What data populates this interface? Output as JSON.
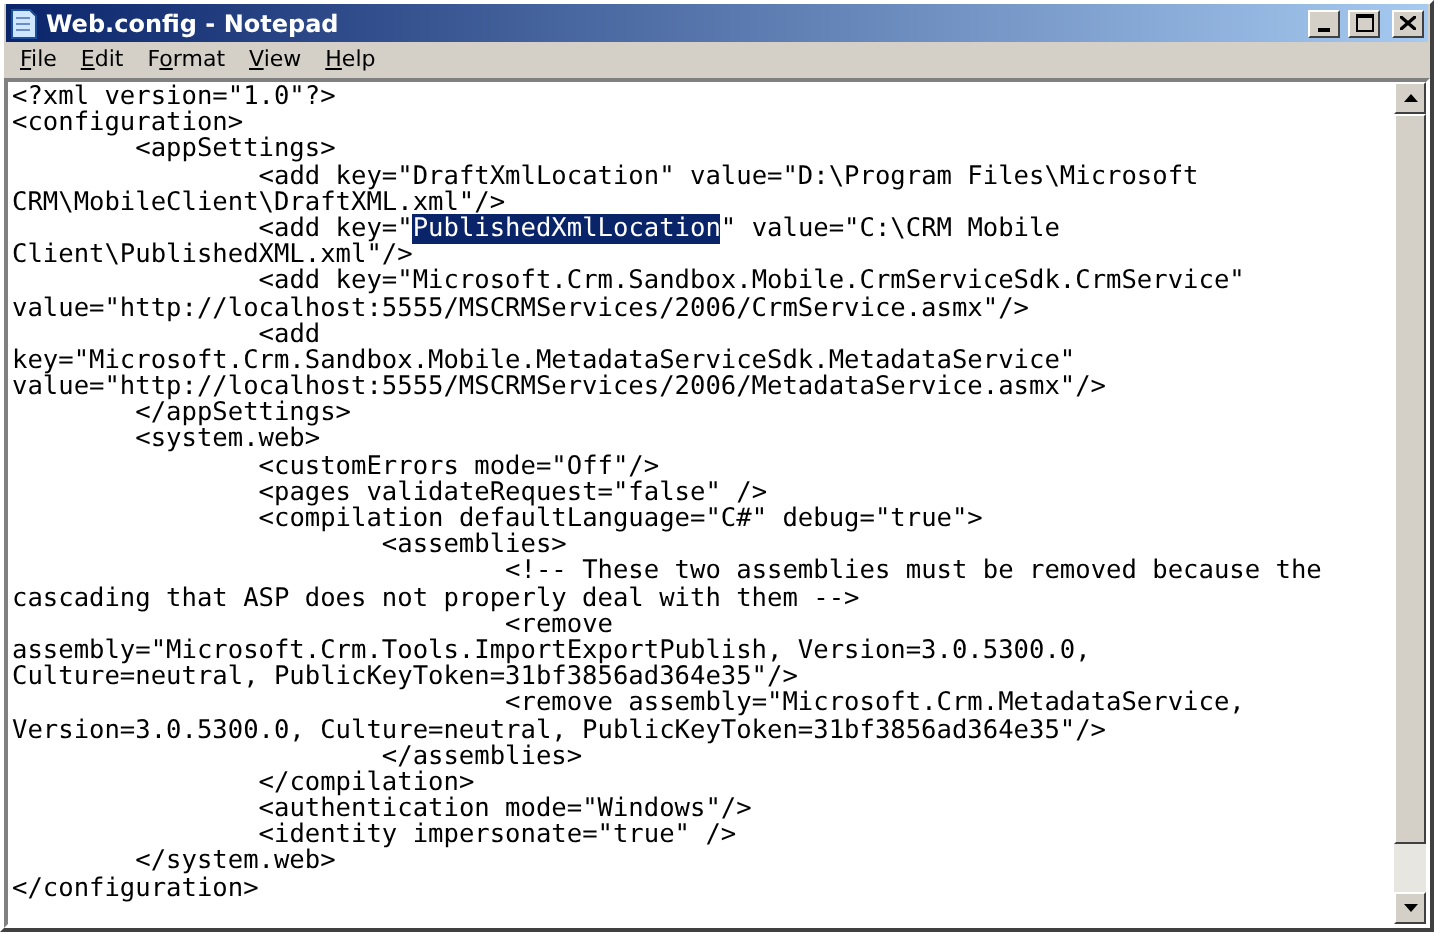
{
  "window": {
    "title": "Web.config - Notepad"
  },
  "menu": [
    {
      "accel": "F",
      "rest": "ile"
    },
    {
      "accel": "E",
      "rest": "dit"
    },
    {
      "pre": "F",
      "accel": "o",
      "rest": "rmat"
    },
    {
      "accel": "V",
      "rest": "iew"
    },
    {
      "accel": "H",
      "rest": "elp"
    }
  ],
  "editor": {
    "lines": [
      [
        {
          "text": "<?xml version=\"1.0\"?>",
          "selected": false
        }
      ],
      [
        {
          "text": "<configuration>",
          "selected": false
        }
      ],
      [
        {
          "text": "\t<appSettings>",
          "selected": false
        }
      ],
      [
        {
          "text": "\t\t<add key=\"DraftXmlLocation\" value=\"D:\\Program Files\\Microsoft",
          "selected": false
        }
      ],
      [
        {
          "text": "CRM\\MobileClient\\DraftXML.xml\"/>",
          "selected": false
        }
      ],
      [
        {
          "text": "\t\t<add key=\"",
          "selected": false
        },
        {
          "text": "PublishedXmlLocation",
          "selected": true
        },
        {
          "text": "\" value=\"C:\\CRM Mobile",
          "selected": false
        }
      ],
      [
        {
          "text": "Client\\PublishedXML.xml\"/>",
          "selected": false
        }
      ],
      [
        {
          "text": "\t\t<add key=\"Microsoft.Crm.Sandbox.Mobile.CrmServiceSdk.CrmService\"",
          "selected": false
        }
      ],
      [
        {
          "text": "value=\"http://localhost:5555/MSCRMServices/2006/CrmService.asmx\"/>",
          "selected": false
        }
      ],
      [
        {
          "text": "\t\t<add",
          "selected": false
        }
      ],
      [
        {
          "text": "key=\"Microsoft.Crm.Sandbox.Mobile.MetadataServiceSdk.MetadataService\"",
          "selected": false
        }
      ],
      [
        {
          "text": "value=\"http://localhost:5555/MSCRMServices/2006/MetadataService.asmx\"/>",
          "selected": false
        }
      ],
      [
        {
          "text": "\t</appSettings>",
          "selected": false
        }
      ],
      [
        {
          "text": "\t<system.web>",
          "selected": false
        }
      ],
      [
        {
          "text": "\t\t<customErrors mode=\"Off\"/>",
          "selected": false
        }
      ],
      [
        {
          "text": "\t\t<pages validateRequest=\"false\" />",
          "selected": false
        }
      ],
      [
        {
          "text": "\t\t<compilation defaultLanguage=\"C#\" debug=\"true\">",
          "selected": false
        }
      ],
      [
        {
          "text": "\t\t\t<assemblies>",
          "selected": false
        }
      ],
      [
        {
          "text": "\t\t\t\t<!-- These two assemblies must be removed because the",
          "selected": false
        }
      ],
      [
        {
          "text": "cascading that ASP does not properly deal with them -->",
          "selected": false
        }
      ],
      [
        {
          "text": "\t\t\t\t<remove",
          "selected": false
        }
      ],
      [
        {
          "text": "assembly=\"Microsoft.Crm.Tools.ImportExportPublish, Version=3.0.5300.0,",
          "selected": false
        }
      ],
      [
        {
          "text": "Culture=neutral, PublicKeyToken=31bf3856ad364e35\"/>",
          "selected": false
        }
      ],
      [
        {
          "text": "\t\t\t\t<remove assembly=\"Microsoft.Crm.MetadataService,",
          "selected": false
        }
      ],
      [
        {
          "text": "Version=3.0.5300.0, Culture=neutral, PublicKeyToken=31bf3856ad364e35\"/>",
          "selected": false
        }
      ],
      [
        {
          "text": "\t\t\t</assemblies>",
          "selected": false
        }
      ],
      [
        {
          "text": "\t\t</compilation>",
          "selected": false
        }
      ],
      [
        {
          "text": "\t\t<authentication mode=\"Windows\"/>",
          "selected": false
        }
      ],
      [
        {
          "text": "\t\t<identity impersonate=\"true\" />",
          "selected": false
        }
      ],
      [
        {
          "text": "\t</system.web>",
          "selected": false
        }
      ],
      [
        {
          "text": "</configuration>",
          "selected": false
        }
      ]
    ]
  }
}
